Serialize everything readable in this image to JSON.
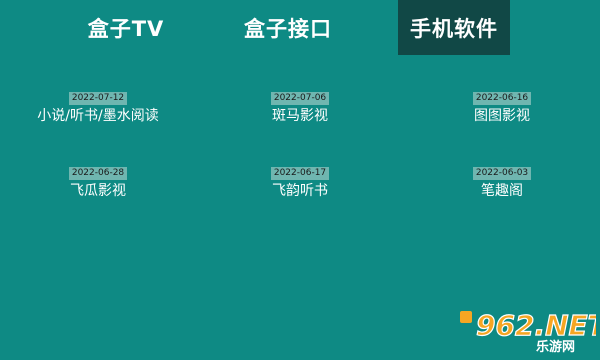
{
  "tabs": [
    {
      "label": "盒子TV"
    },
    {
      "label": "盒子接口"
    },
    {
      "label": "手机软件",
      "active": true
    }
  ],
  "items": [
    {
      "date": "2022-07-12",
      "name": "小说/听书/墨水阅读"
    },
    {
      "date": "2022-07-06",
      "name": "斑马影视"
    },
    {
      "date": "2022-06-16",
      "name": "图图影视"
    },
    {
      "date": "2022-06-28",
      "name": "飞瓜影视"
    },
    {
      "date": "2022-06-17",
      "name": "飞韵听书"
    },
    {
      "date": "2022-06-03",
      "name": "笔趣阁"
    }
  ],
  "watermark": {
    "logo": "962.NET",
    "subtitle": "乐游网"
  },
  "colors": {
    "background": "#0e8a84",
    "active_tab": "#114846",
    "date_badge": "#6fb6b0"
  }
}
